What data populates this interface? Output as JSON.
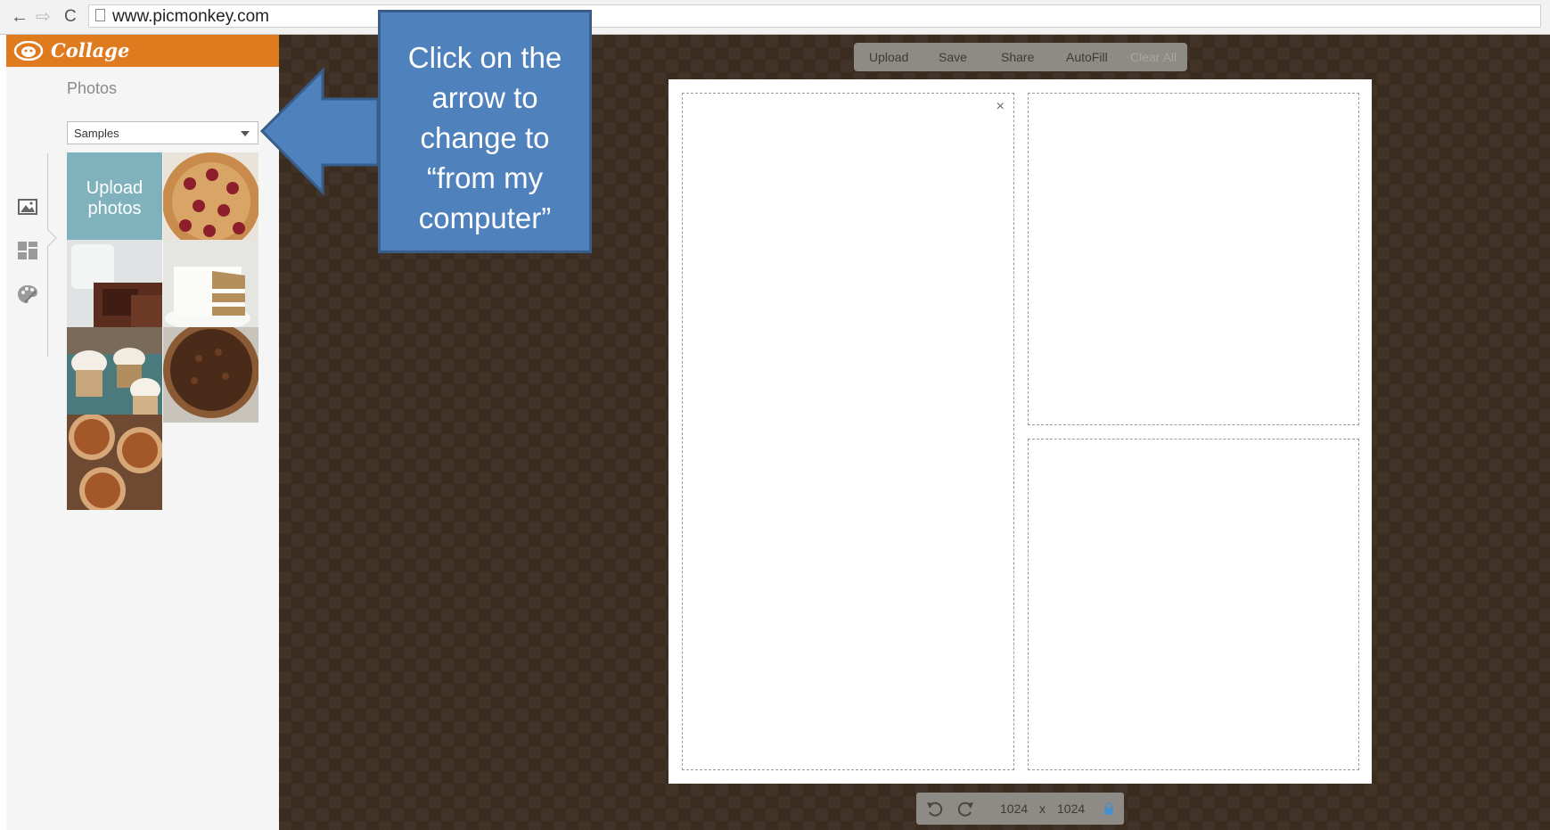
{
  "browser": {
    "url": "www.picmonkey.com",
    "back_icon": "←",
    "forward_icon": "⇨",
    "reload_icon": "C"
  },
  "sidebar": {
    "app_title": "Collage",
    "section_title": "Photos",
    "source_select": {
      "selected": "Samples"
    },
    "upload_tile": {
      "line1": "Upload",
      "line2": "photos"
    },
    "tools": [
      "photos-icon",
      "layouts-icon",
      "paint-icon"
    ],
    "sample_photos": [
      "cherry-pie",
      "brownies",
      "layer-cake",
      "cupcakes",
      "pecan-pie",
      "pumpkin-tarts"
    ]
  },
  "toolbar": {
    "upload": "Upload",
    "save": "Save",
    "share": "Share",
    "autofill": "AutoFill",
    "clear_all": "Clear All"
  },
  "collage": {
    "close_glyph": "×",
    "cells": 3
  },
  "bottom_bar": {
    "width": "1024",
    "times": "x",
    "height": "1024"
  },
  "callout": {
    "text": "Click on the\narrow to\nchange to\n“from my\ncomputer”"
  },
  "colors": {
    "header_orange": "#e07a1f",
    "upload_tile": "#7fb2bd",
    "callout_blue": "#4f81bd",
    "canvas_bg": "#3a2c1f"
  }
}
